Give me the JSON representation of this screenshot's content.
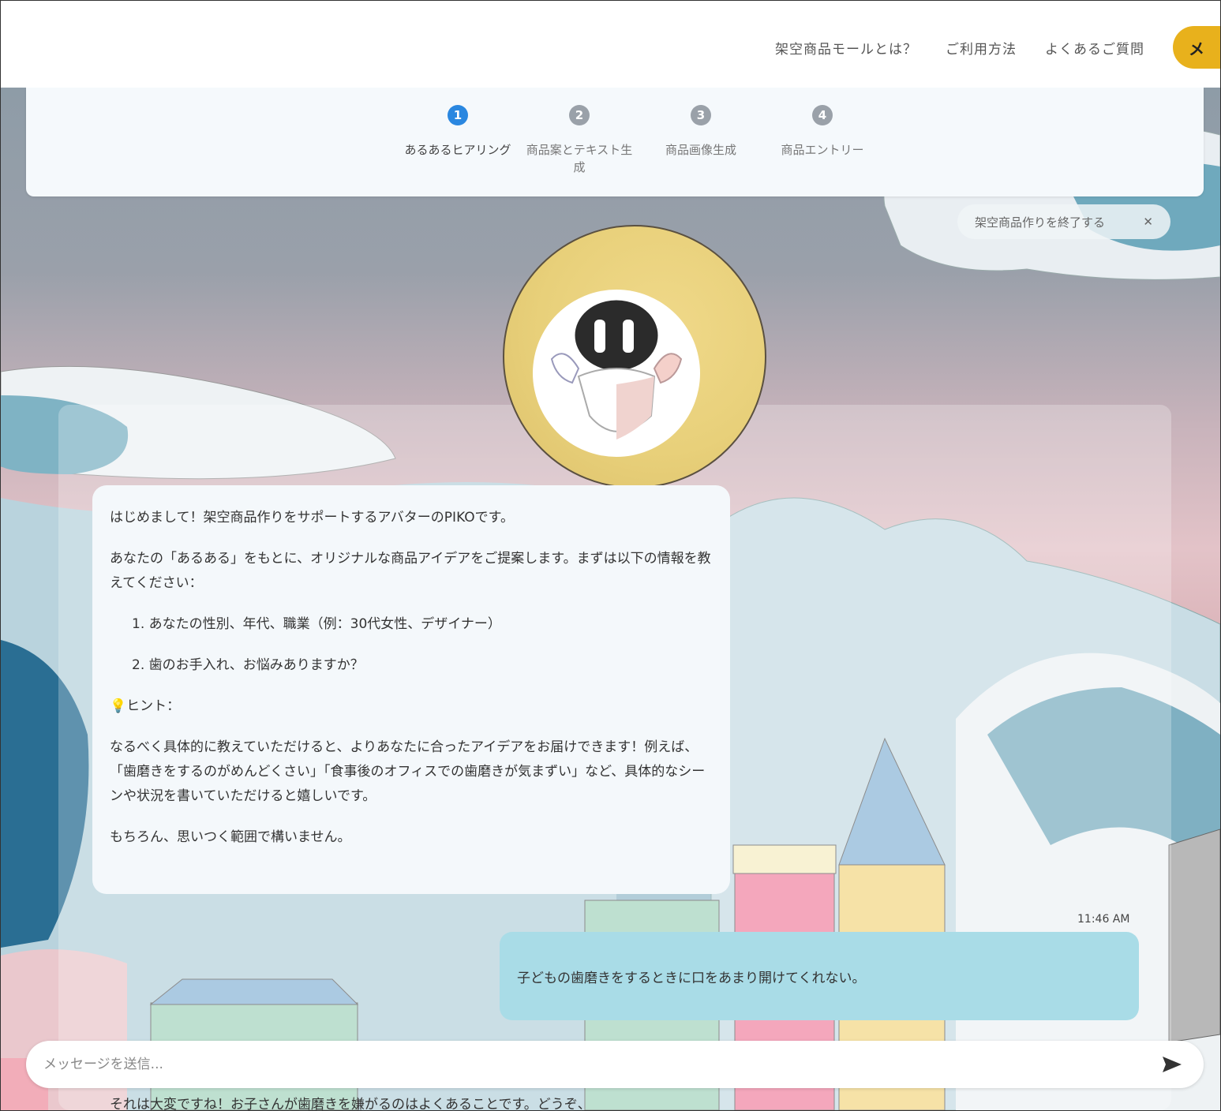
{
  "nav": {
    "items": [
      "架空商品モールとは？",
      "ご利用方法",
      "よくあるご質問"
    ],
    "cta_label": "メ"
  },
  "stepper": {
    "steps": [
      {
        "num": "1",
        "label": "あるあるヒアリング"
      },
      {
        "num": "2",
        "label": "商品案とテキスト生成"
      },
      {
        "num": "3",
        "label": "商品画像生成"
      },
      {
        "num": "4",
        "label": "商品エントリー"
      }
    ]
  },
  "end_pill": {
    "label": "架空商品作りを終了する",
    "close": "✕"
  },
  "bot_message": {
    "p1": "はじめまして！架空商品作りをサポートするアバターのPIKOです。",
    "p2": "あなたの「あるある」をもとに、オリジナルな商品アイデアをご提案します。まずは以下の情報を教えてください：",
    "li1": "1. あなたの性別、年代、職業（例：30代女性、デザイナー）",
    "li2": "2. 歯のお手入れ、お悩みありますか？",
    "hint": "ヒント：",
    "p3": "なるべく具体的に教えていただけると、よりあなたに合ったアイデアをお届けできます！例えば、「歯磨きをするのがめんどくさい」「食事後のオフィスでの歯磨きが気まずい」など、具体的なシーンや状況を書いていただけると嬉しいです。",
    "p4": "もちろん、思いつく範囲で構いません。"
  },
  "timestamp": "11:46 AM",
  "user_message": "子どもの歯磨きをするときに口をあまり開けてくれない。",
  "input": {
    "placeholder": "メッセージを送信..."
  },
  "next_message_partial": "それは大変ですね！お子さんが歯磨きを嫌がるのはよくあることです。どうぞ、",
  "colors": {
    "accent": "#2a87e0",
    "cta": "#e8b11c",
    "user_bubble": "#a9dce7"
  }
}
